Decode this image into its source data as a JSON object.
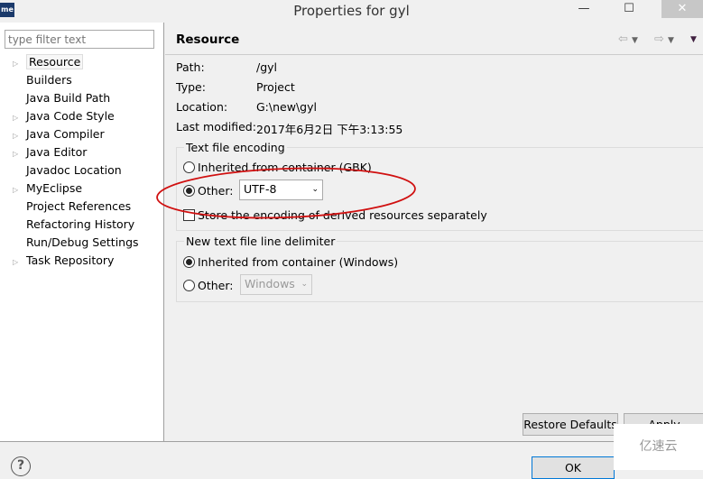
{
  "window": {
    "title": "Properties for gyl",
    "logo": "me",
    "minimize": "—",
    "maximize": "☐",
    "close": "✕"
  },
  "sidebar": {
    "filter_placeholder": "type filter text",
    "items": [
      {
        "label": "Resource",
        "expandable": true,
        "selected": true
      },
      {
        "label": "Builders",
        "expandable": false
      },
      {
        "label": "Java Build Path",
        "expandable": false
      },
      {
        "label": "Java Code Style",
        "expandable": true
      },
      {
        "label": "Java Compiler",
        "expandable": true
      },
      {
        "label": "Java Editor",
        "expandable": true
      },
      {
        "label": "Javadoc Location",
        "expandable": false
      },
      {
        "label": "MyEclipse",
        "expandable": true
      },
      {
        "label": "Project References",
        "expandable": false
      },
      {
        "label": "Refactoring History",
        "expandable": false
      },
      {
        "label": "Run/Debug Settings",
        "expandable": false
      },
      {
        "label": "Task Repository",
        "expandable": true
      }
    ]
  },
  "page": {
    "title": "Resource",
    "info": [
      {
        "label": "Path:",
        "value": "/gyl"
      },
      {
        "label": "Type:",
        "value": "Project"
      },
      {
        "label": "Location:",
        "value": "G:\\new\\gyl"
      },
      {
        "label": "Last modified:",
        "value": "2017年6月2日 下午3:13:55"
      }
    ],
    "encoding": {
      "title": "Text file encoding",
      "inherited": "Inherited from container (GBK)",
      "other": "Other:",
      "value": "UTF-8",
      "selected": "other",
      "store_derived": "Store the encoding of derived resources separately",
      "store_checked": false
    },
    "delimiter": {
      "title": "New text file line delimiter",
      "inherited": "Inherited from container (Windows)",
      "other": "Other:",
      "value": "Windows",
      "selected": "inherited"
    },
    "restore_defaults": "Restore Defaults",
    "apply": "Apply"
  },
  "footer": {
    "help": "?",
    "ok": "OK"
  },
  "watermark": "亿速云",
  "colors": {
    "annotation": "#d01010"
  }
}
